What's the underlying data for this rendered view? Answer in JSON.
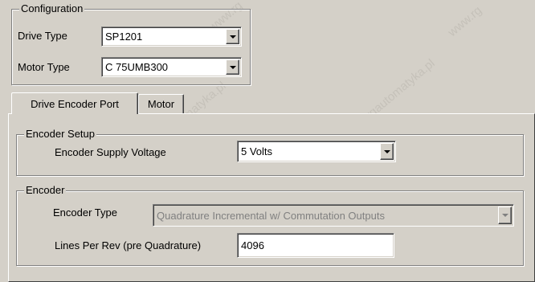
{
  "configuration": {
    "caption": "Configuration",
    "drive_type": {
      "label": "Drive Type",
      "value": "SP1201"
    },
    "motor_type": {
      "label": "Motor Type",
      "value": "C 75UMB300"
    }
  },
  "tabs": [
    {
      "label": "Drive Encoder Port",
      "active": true
    },
    {
      "label": "Motor",
      "active": false
    }
  ],
  "encoder_setup": {
    "caption": "Encoder Setup",
    "supply_voltage": {
      "label": "Encoder Supply Voltage",
      "value": "5 Volts"
    }
  },
  "encoder": {
    "caption": "Encoder",
    "type": {
      "label": "Encoder Type",
      "value": "Quadrature Incremental w/ Commutation Outputs",
      "enabled": false
    },
    "lines_per_rev": {
      "label": "Lines Per Rev (pre Quadrature)",
      "value": "4096"
    }
  },
  "watermark": {
    "text": "www.rgautomatyka.pl",
    "short": "www.rg"
  }
}
